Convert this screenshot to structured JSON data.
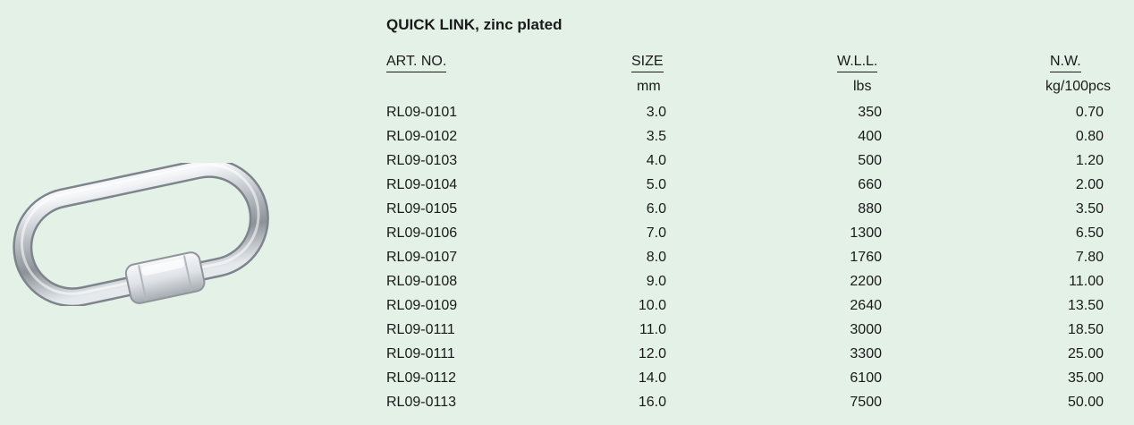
{
  "title": "QUICK LINK, zinc plated",
  "columns": [
    {
      "header": "ART. NO.",
      "unit": ""
    },
    {
      "header": "SIZE",
      "unit": "mm"
    },
    {
      "header": "W.L.L.",
      "unit": "lbs"
    },
    {
      "header": "N.W.",
      "unit": "kg/100pcs"
    }
  ],
  "rows": [
    {
      "art": "RL09-0101",
      "size": "3.0",
      "wll": "350",
      "nw": "0.70"
    },
    {
      "art": "RL09-0102",
      "size": "3.5",
      "wll": "400",
      "nw": "0.80"
    },
    {
      "art": "RL09-0103",
      "size": "4.0",
      "wll": "500",
      "nw": "1.20"
    },
    {
      "art": "RL09-0104",
      "size": "5.0",
      "wll": "660",
      "nw": "2.00"
    },
    {
      "art": "RL09-0105",
      "size": "6.0",
      "wll": "880",
      "nw": "3.50"
    },
    {
      "art": "RL09-0106",
      "size": "7.0",
      "wll": "1300",
      "nw": "6.50"
    },
    {
      "art": "RL09-0107",
      "size": "8.0",
      "wll": "1760",
      "nw": "7.80"
    },
    {
      "art": "RL09-0108",
      "size": "9.0",
      "wll": "2200",
      "nw": "11.00"
    },
    {
      "art": "RL09-0109",
      "size": "10.0",
      "wll": "2640",
      "nw": "13.50"
    },
    {
      "art": "RL09-0111",
      "size": "11.0",
      "wll": "3000",
      "nw": "18.50"
    },
    {
      "art": "RL09-0111",
      "size": "12.0",
      "wll": "3300",
      "nw": "25.00"
    },
    {
      "art": "RL09-0112",
      "size": "14.0",
      "wll": "6100",
      "nw": "35.00"
    },
    {
      "art": "RL09-0113",
      "size": "16.0",
      "wll": "7500",
      "nw": "50.00"
    }
  ],
  "colors": {
    "background": "#e3f1e7",
    "text": "#1a1a1a",
    "metal": "#c8ccd0"
  }
}
